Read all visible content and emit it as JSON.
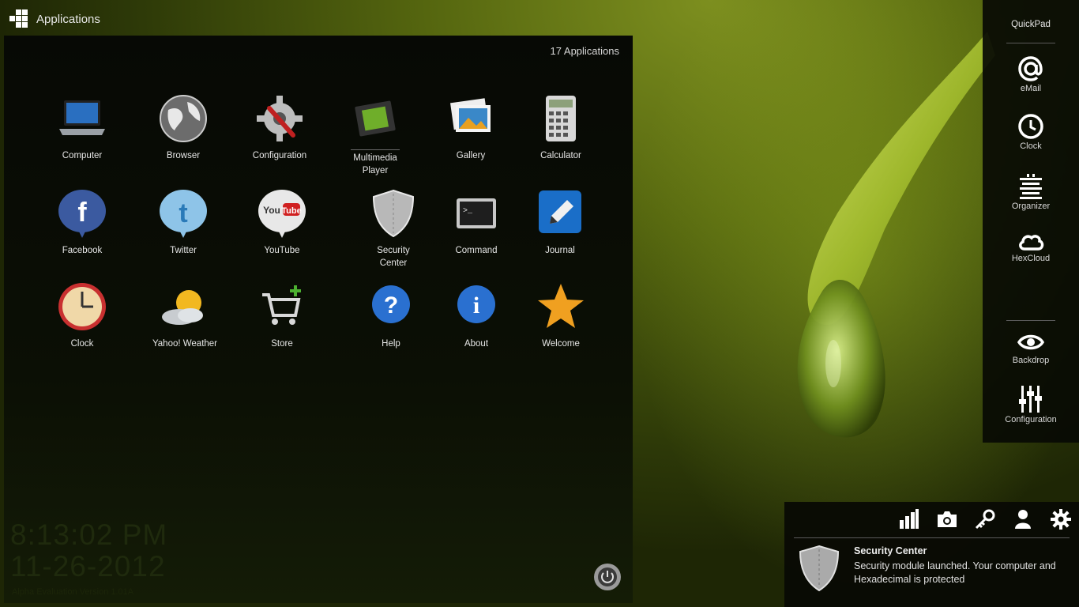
{
  "launcher": {
    "label": "Applications",
    "icon": "grid-logo-icon"
  },
  "apps_window": {
    "count_label": "17 Applications",
    "apps": [
      {
        "label": "Computer",
        "icon": "laptop-icon"
      },
      {
        "label": "Browser",
        "icon": "globe-icon"
      },
      {
        "label": "Configuration",
        "icon": "gear-wrench-icon"
      },
      {
        "label": "Multimedia Player",
        "icon": "film-icon"
      },
      {
        "label": "Gallery",
        "icon": "photos-icon"
      },
      {
        "label": "Calculator",
        "icon": "calculator-icon"
      },
      {
        "label": "Facebook",
        "icon": "facebook-icon"
      },
      {
        "label": "Twitter",
        "icon": "twitter-icon"
      },
      {
        "label": "YouTube",
        "icon": "youtube-icon"
      },
      {
        "label": "Security Center",
        "icon": "shield-icon"
      },
      {
        "label": "Command",
        "icon": "terminal-icon"
      },
      {
        "label": "Journal",
        "icon": "pencil-icon"
      },
      {
        "label": "Clock",
        "icon": "clock-icon"
      },
      {
        "label": "Yahoo! Weather",
        "icon": "weather-icon"
      },
      {
        "label": "Store",
        "icon": "cart-icon"
      },
      {
        "label": "Help",
        "icon": "help-icon"
      },
      {
        "label": "About",
        "icon": "info-icon"
      },
      {
        "label": "Welcome",
        "icon": "star-icon"
      }
    ],
    "time": "8:13:02 PM",
    "date": "11-26-2012",
    "version": "Alpha Evaluation Version 1.01A"
  },
  "dock": {
    "title": "QuickPad",
    "items": [
      {
        "label": "eMail",
        "icon": "at-icon"
      },
      {
        "label": "Clock",
        "icon": "clock-outline-icon"
      },
      {
        "label": "Organizer",
        "icon": "organizer-icon"
      },
      {
        "label": "HexCloud",
        "icon": "cloud-icon"
      },
      {
        "label": "Backdrop",
        "icon": "eye-icon"
      },
      {
        "label": "Configuration",
        "icon": "sliders-icon"
      }
    ]
  },
  "notification": {
    "title": "Security Center",
    "message": "Security module launched. Your computer and Hexadecimal is protected",
    "toolbar_icons": [
      "signal-bars-icon",
      "camera-icon",
      "key-icon",
      "user-icon",
      "settings-gear-icon"
    ]
  },
  "colors": {
    "wallpaper": "#55660f",
    "panel": "#080a04",
    "text": "#e6e6e6"
  }
}
